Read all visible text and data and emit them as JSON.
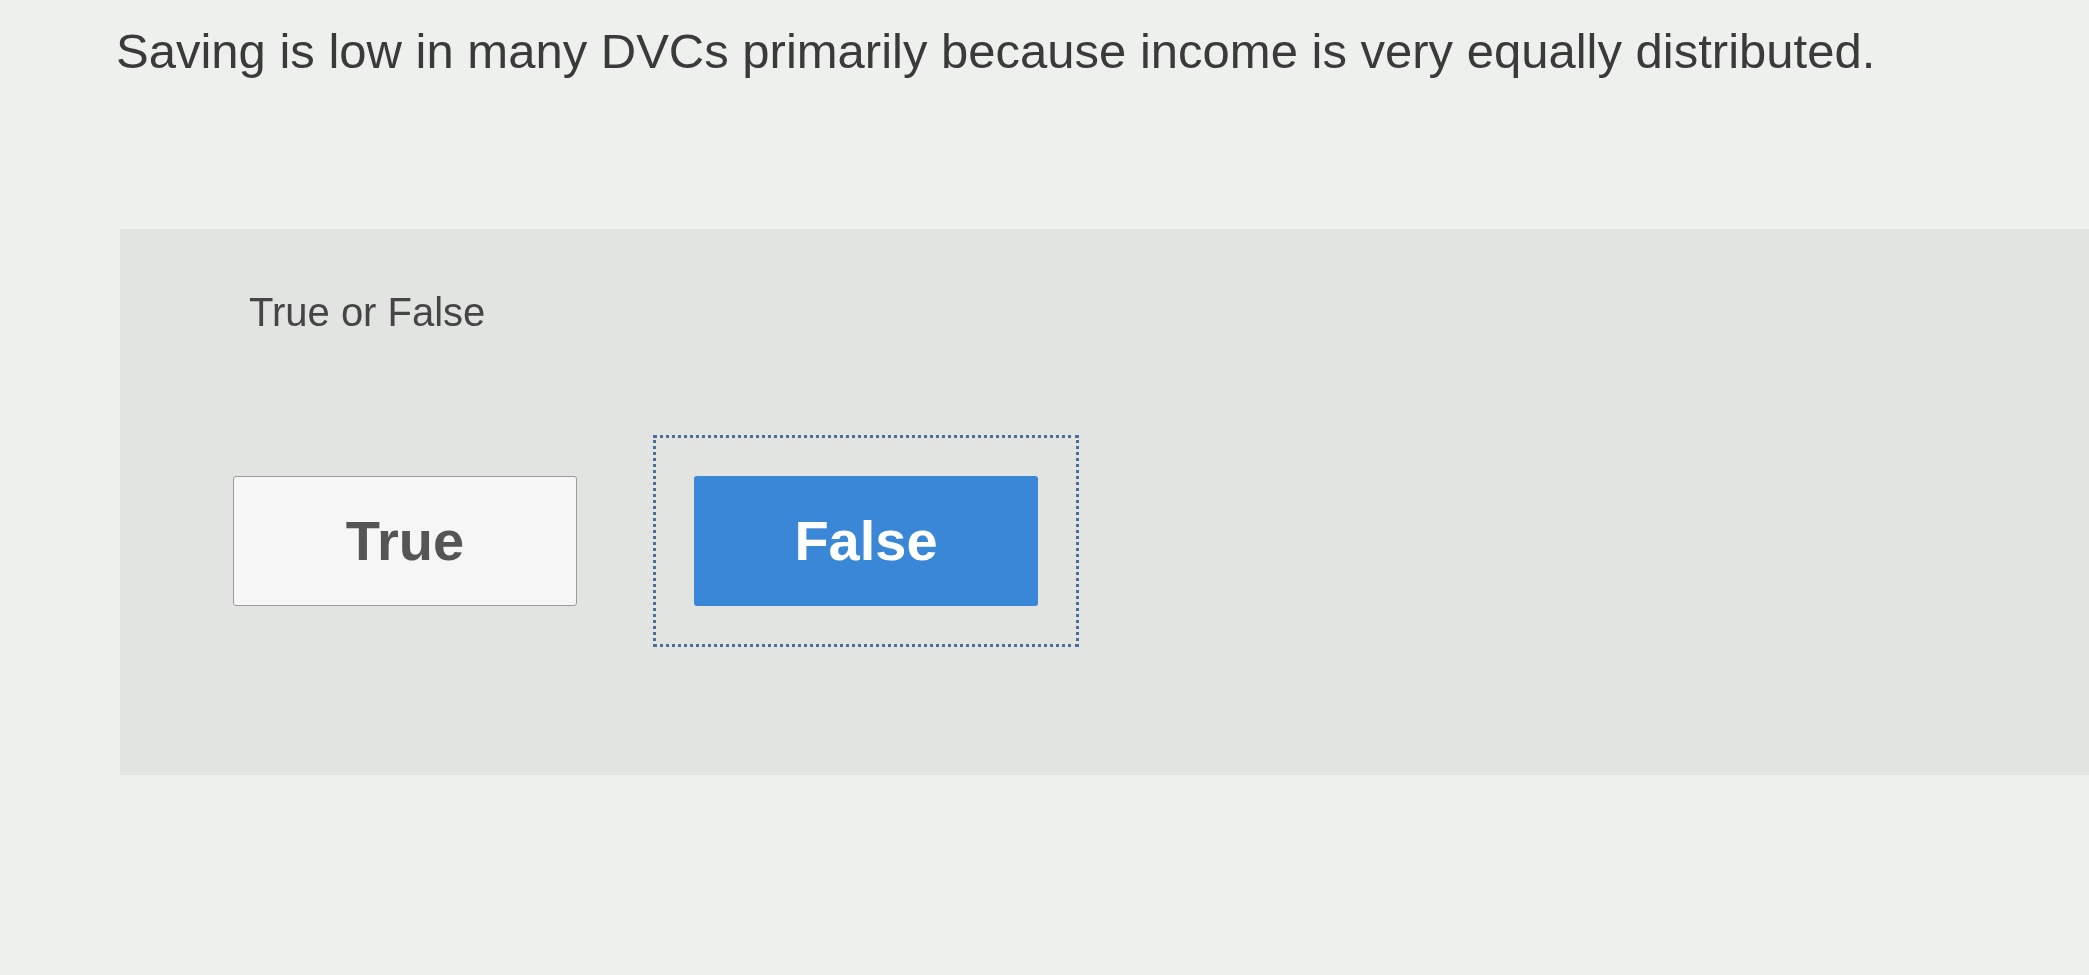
{
  "question": {
    "text": "Saving is low in many DVCs primarily because income is very equally distributed."
  },
  "prompt": "True or False",
  "options": [
    {
      "label": "True",
      "selected": false,
      "focused": false
    },
    {
      "label": "False",
      "selected": true,
      "focused": true
    }
  ]
}
